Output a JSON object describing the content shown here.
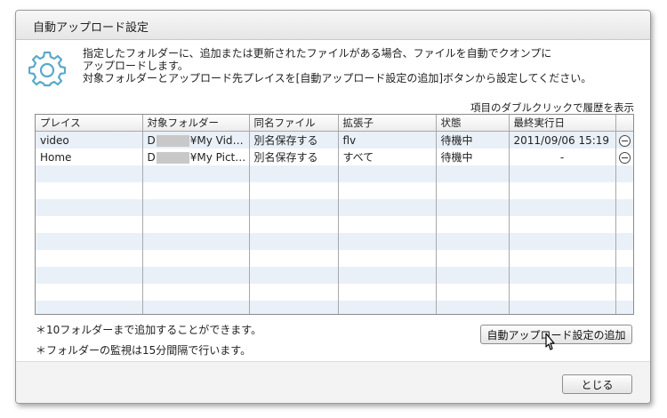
{
  "dialog": {
    "title": "自動アップロード設定",
    "description": [
      "指定したフォルダーに、追加または更新されたファイルがある場合、ファイルを自動でクオンプに",
      "アップロードします。",
      "対象フォルダーとアップロード先プレイスを[自動アップロード設定の追加]ボタンから設定してください。"
    ],
    "hint": "項目のダブルクリックで履歴を表示"
  },
  "table": {
    "columns": [
      "プレイス",
      "対象フォルダー",
      "同名ファイル",
      "拡張子",
      "状態",
      "最終実行日"
    ],
    "rows": [
      {
        "place": "video",
        "folder_prefix": "D",
        "folder_suffix": "¥My Vide...",
        "same_name": "別名保存する",
        "ext": "flv",
        "status": "待機中",
        "last_run": "2011/09/06 15:19"
      },
      {
        "place": "Home",
        "folder_prefix": "D",
        "folder_suffix": "¥My Pictu...",
        "same_name": "別名保存する",
        "ext": "すべて",
        "status": "待機中",
        "last_run": "-"
      }
    ]
  },
  "notes": [
    "＊10フォルダーまで追加することができます。",
    "＊フォルダーの監視は15分間隔で行います。"
  ],
  "buttons": {
    "add_label": "自動アップロード設定の追加",
    "close_label": "とじる"
  },
  "icons": {
    "gear": "gear-icon",
    "remove": "remove-icon",
    "cursor": "mouse-cursor-icon"
  },
  "colors": {
    "gear_outline": "#5aa9c9",
    "row_alt": "#eaf0f8"
  }
}
